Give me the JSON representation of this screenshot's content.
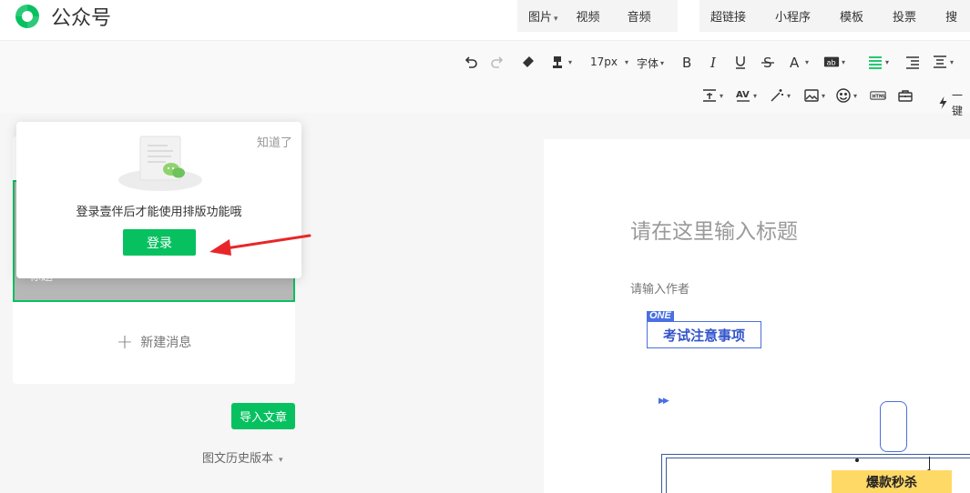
{
  "header": {
    "app_title": "公众号",
    "insert_menu": [
      {
        "label": "图片",
        "dropdown": true
      },
      {
        "label": "视频"
      },
      {
        "label": "音频"
      },
      {
        "label": "超链接"
      },
      {
        "label": "小程序"
      },
      {
        "label": "模板"
      },
      {
        "label": "投票"
      },
      {
        "label": "搜"
      }
    ]
  },
  "toolbar": {
    "font_size": "17px",
    "font_family": "字体",
    "one_key": "一键"
  },
  "left_panel": {
    "slot_title": "标题",
    "new_message": "新建消息",
    "import_button": "导入文章",
    "history_version": "图文历史版本"
  },
  "popup": {
    "dismiss": "知道了",
    "message": "登录壹伴后才能使用排版功能哦",
    "login_button": "登录"
  },
  "editor": {
    "title_placeholder": "请在这里输入标题",
    "author_placeholder": "请输入作者",
    "section_tag": "ONE",
    "section_title": "考试注意事项",
    "sale_banner": "爆款秒杀"
  },
  "colors": {
    "brand_green": "#07c160",
    "accent_blue": "#4a6fe0",
    "arrow_red": "#e8262a",
    "sale_yellow": "#ffd966"
  }
}
